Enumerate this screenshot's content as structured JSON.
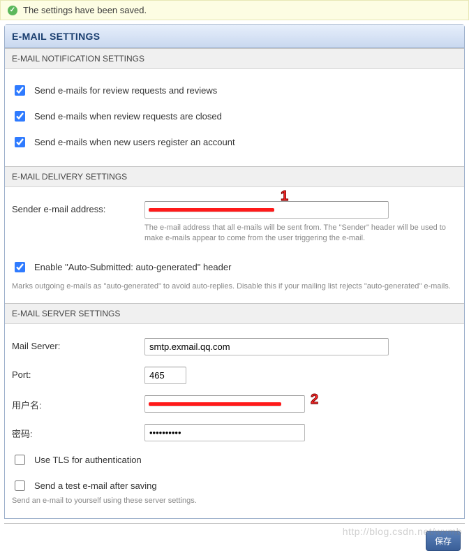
{
  "alert": {
    "text": "The settings have been saved."
  },
  "panel": {
    "title": "E-MAIL SETTINGS"
  },
  "notif": {
    "header": "E-MAIL NOTIFICATION SETTINGS",
    "checks": [
      {
        "label": "Send e-mails for review requests and reviews",
        "checked": true
      },
      {
        "label": "Send e-mails when review requests are closed",
        "checked": true
      },
      {
        "label": "Send e-mails when new users register an account",
        "checked": true
      }
    ]
  },
  "delivery": {
    "header": "E-MAIL DELIVERY SETTINGS",
    "sender_label": "Sender e-mail address:",
    "sender_value": "",
    "sender_help": "The e-mail address that all e-mails will be sent from. The \"Sender\" header will be used to make e-mails appear to come from the user triggering the e-mail.",
    "auto_label": "Enable \"Auto-Submitted: auto-generated\" header",
    "auto_checked": true,
    "auto_help": "Marks outgoing e-mails as \"auto-generated\" to avoid auto-replies. Disable this if your mailing list rejects \"auto-generated\" e-mails."
  },
  "server": {
    "header": "E-MAIL SERVER SETTINGS",
    "mail_server_label": "Mail Server:",
    "mail_server_value": "smtp.exmail.qq.com",
    "port_label": "Port:",
    "port_value": "465",
    "username_label": "用户名:",
    "username_value": "",
    "password_label": "密码:",
    "password_value": "••••••••••",
    "tls_label": "Use TLS for authentication",
    "tls_checked": false,
    "test_label": "Send a test e-mail after saving",
    "test_checked": false,
    "test_help": "Send an e-mail to yourself using these server settings."
  },
  "footer": {
    "save_label": "保存"
  },
  "callouts": {
    "one": "1",
    "two": "2"
  },
  "watermark": "http://blog.csdn.net/wxmb"
}
